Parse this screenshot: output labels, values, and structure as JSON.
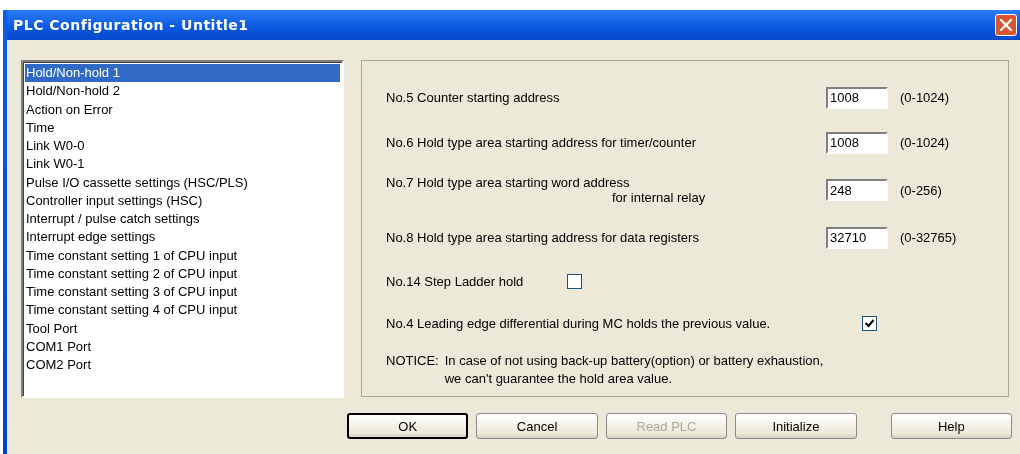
{
  "window": {
    "title": "PLC Configuration - Untitle1"
  },
  "nav_list": [
    {
      "label": "Hold/Non-hold 1",
      "selected": true
    },
    {
      "label": "Hold/Non-hold 2",
      "selected": false
    },
    {
      "label": "Action on Error",
      "selected": false
    },
    {
      "label": "Time",
      "selected": false
    },
    {
      "label": "Link W0-0",
      "selected": false
    },
    {
      "label": "Link W0-1",
      "selected": false
    },
    {
      "label": "Pulse I/O cassette settings (HSC/PLS)",
      "selected": false
    },
    {
      "label": "Controller input settings (HSC)",
      "selected": false
    },
    {
      "label": "Interrupt / pulse catch settings",
      "selected": false
    },
    {
      "label": "Interrupt edge settings",
      "selected": false
    },
    {
      "label": "Time constant setting 1 of CPU input",
      "selected": false
    },
    {
      "label": "Time constant setting 2 of CPU input",
      "selected": false
    },
    {
      "label": "Time constant setting 3 of CPU input",
      "selected": false
    },
    {
      "label": "Time constant setting 4 of CPU input",
      "selected": false
    },
    {
      "label": "Tool Port",
      "selected": false
    },
    {
      "label": "COM1 Port",
      "selected": false
    },
    {
      "label": "COM2 Port",
      "selected": false
    }
  ],
  "settings": [
    {
      "kind": "field",
      "label": "No.5 Counter starting address",
      "value": "1008",
      "range": "(0-1024)"
    },
    {
      "kind": "field",
      "label": "No.6 Hold type area starting address for timer/counter",
      "value": "1008",
      "range": "(0-1024)"
    },
    {
      "kind": "field",
      "label": "No.7 Hold type area starting word address",
      "label_continuation": "for internal relay",
      "value": "248",
      "range": "(0-256)"
    },
    {
      "kind": "field",
      "label": "No.8 Hold type area starting address for data registers",
      "value": "32710",
      "range": "(0-32765)"
    },
    {
      "kind": "checkbox",
      "label": "No.14 Step Ladder hold",
      "checked": false
    },
    {
      "kind": "checkbox",
      "label": "No.4 Leading edge differential during MC holds the previous value.",
      "checked": true
    }
  ],
  "notice": {
    "heading": "NOTICE:",
    "lines": [
      "In case of not using back-up battery(option) or battery exhaustion,",
      "we can't guarantee the hold area value."
    ]
  },
  "buttons": [
    {
      "label": "OK",
      "default": true,
      "disabled": false
    },
    {
      "label": "Cancel",
      "default": false,
      "disabled": false
    },
    {
      "label": "Read PLC",
      "default": false,
      "disabled": true
    },
    {
      "label": "Initialize",
      "default": false,
      "disabled": false
    },
    {
      "label": "Help",
      "default": false,
      "disabled": false
    }
  ]
}
